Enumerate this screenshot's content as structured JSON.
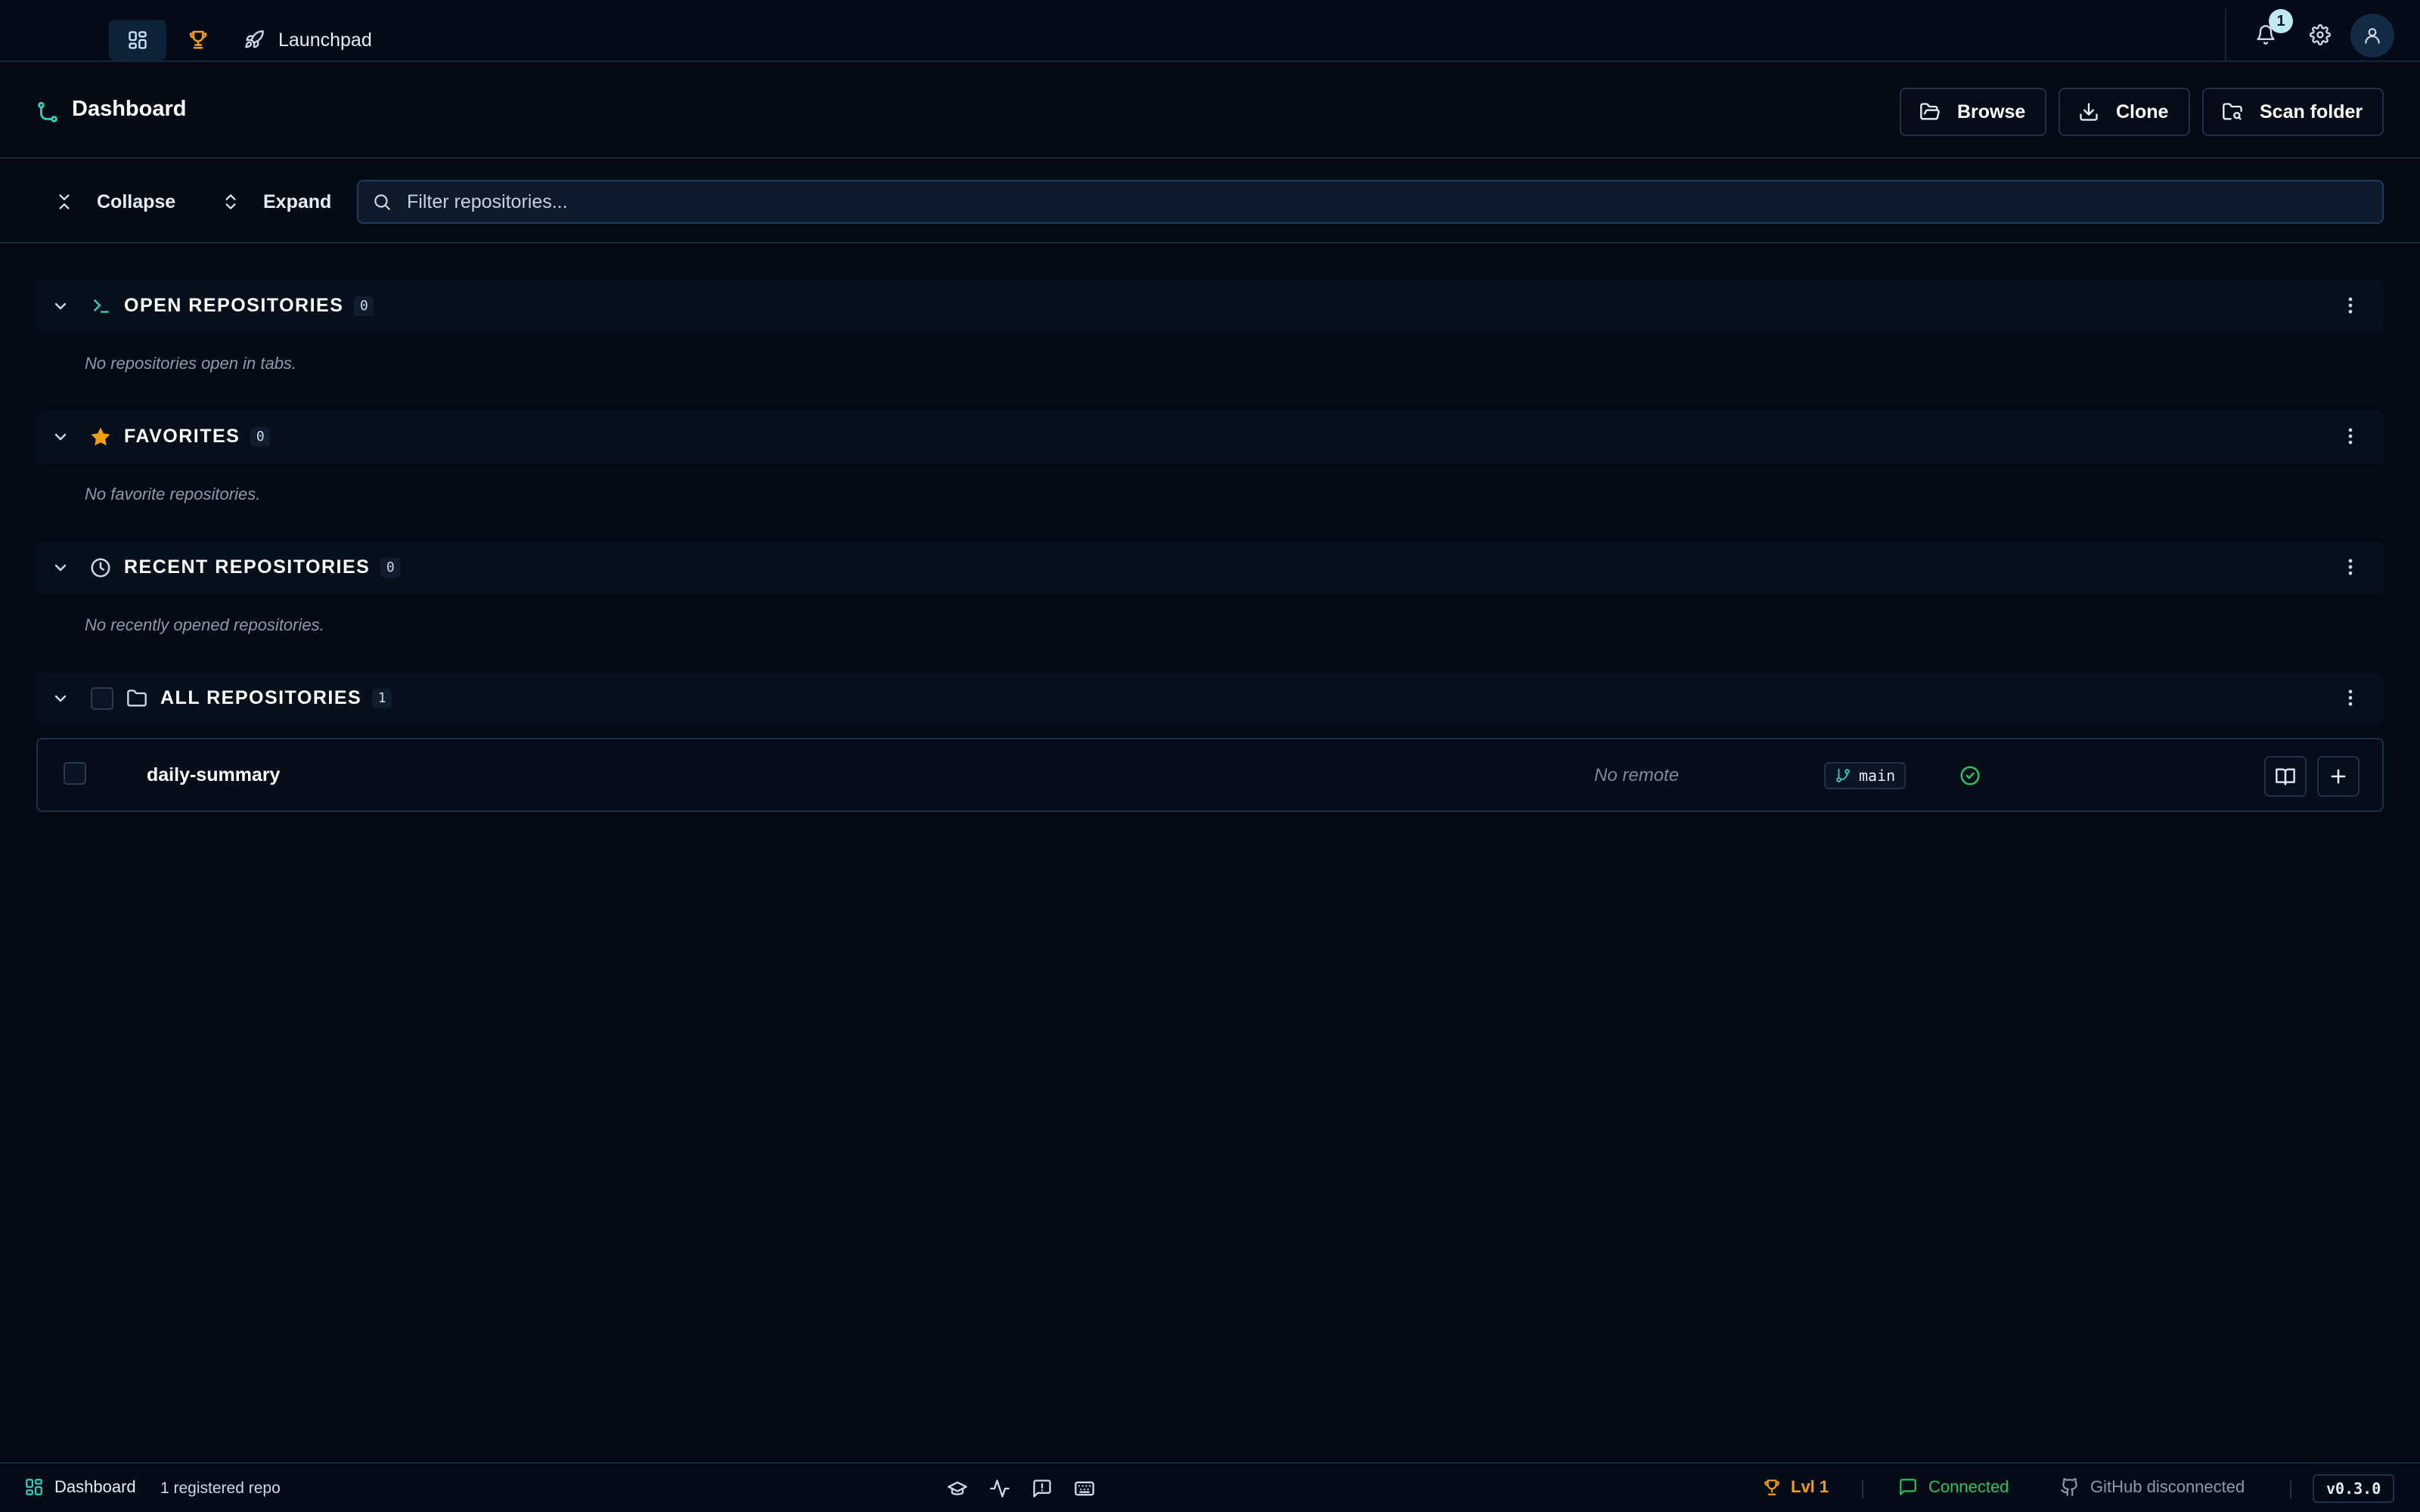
{
  "colors": {
    "accent_teal": "#2dd4bf",
    "trophy_orange": "#f59e0b",
    "connected_green": "#22c55e",
    "background": "#040a14"
  },
  "topbar": {
    "home_icon": "dashboard-grid-icon",
    "trophy_icon": "trophy-icon",
    "launchpad_label": "Launchpad",
    "launchpad_icon": "rocket-icon",
    "notification_count": "1",
    "bell_icon": "bell-icon",
    "settings_icon": "gear-icon",
    "user_icon": "user-icon"
  },
  "page": {
    "title": "Dashboard",
    "title_icon": "git-branch-icon",
    "actions": {
      "browse": "Browse",
      "clone": "Clone",
      "scan": "Scan folder"
    }
  },
  "toolbar": {
    "collapse": "Collapse",
    "expand": "Expand",
    "filter_placeholder": "Filter repositories...",
    "filter_value": ""
  },
  "sections": {
    "open": {
      "title": "OPEN REPOSITORIES",
      "count": "0",
      "empty": "No repositories open in tabs.",
      "icon": "terminal-icon"
    },
    "favorites": {
      "title": "FAVORITES",
      "count": "0",
      "empty": "No favorite repositories.",
      "icon": "star-icon"
    },
    "recent": {
      "title": "RECENT REPOSITORIES",
      "count": "0",
      "empty": "No recently opened repositories.",
      "icon": "clock-icon"
    },
    "all": {
      "title": "ALL REPOSITORIES",
      "count": "1",
      "icon": "folder-icon"
    }
  },
  "repos": [
    {
      "name": "daily-summary",
      "remote": "No remote",
      "branch": "main",
      "status_icon": "check-circle-icon"
    }
  ],
  "statusbar": {
    "dashboard_label": "Dashboard",
    "repo_count": "1 registered repo",
    "icons": [
      "graduation-cap-icon",
      "activity-icon",
      "feedback-icon",
      "keyboard-icon"
    ],
    "level": "Lvl 1",
    "connection": "Connected",
    "github": "GitHub disconnected",
    "version": "v0.3.0"
  }
}
